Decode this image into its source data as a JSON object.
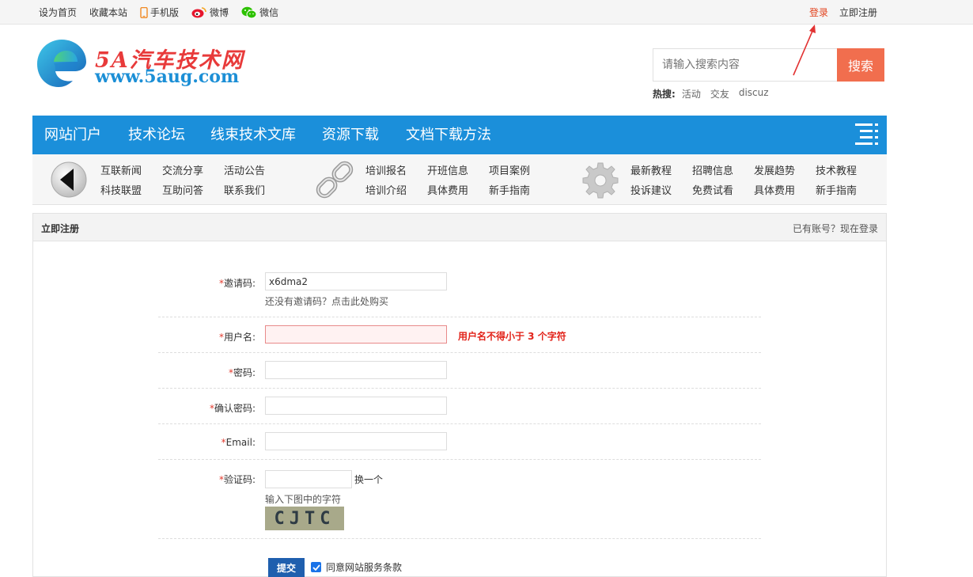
{
  "topbar": {
    "set_home": "设为首页",
    "bookmark": "收藏本站",
    "mobile": "手机版",
    "weibo": "微博",
    "wechat": "微信",
    "login": "登录",
    "register": "立即注册"
  },
  "logo": {
    "title": "5A汽车技术网",
    "url": "www.5aug.com"
  },
  "search": {
    "placeholder": "请输入搜索内容",
    "button": "搜索",
    "hot_label": "热搜:",
    "hot_keywords": [
      "活动",
      "交友",
      "discuz"
    ]
  },
  "mainnav": {
    "items": [
      "网站门户",
      "技术论坛",
      "线束技术文库",
      "资源下载",
      "文档下载方法"
    ]
  },
  "subnav": {
    "group1": [
      "互联新闻",
      "交流分享",
      "活动公告",
      "科技联盟",
      "互助问答",
      "联系我们"
    ],
    "group2": [
      "培训报名",
      "开班信息",
      "项目案例",
      "培训介绍",
      "具体费用",
      "新手指南"
    ],
    "group3": [
      "最新教程",
      "招聘信息",
      "发展趋势",
      "技术教程",
      "投诉建议",
      "免费试看",
      "具体费用",
      "新手指南"
    ]
  },
  "panel": {
    "title": "立即注册",
    "have_account": "已有账号？现在登录"
  },
  "form": {
    "invite_label": "邀请码:",
    "invite_value": "x6dma2",
    "invite_tip": "还没有邀请码？点击此处购买",
    "username_label": "用户名:",
    "username_error": "用户名不得小于 3 个字符",
    "password_label": "密码:",
    "confirm_label": "确认密码:",
    "email_label": "Email:",
    "captcha_label": "验证码:",
    "captcha_refresh": "换一个",
    "captcha_tip": "输入下图中的字符",
    "captcha_text": "CJTC",
    "star": "*",
    "submit": "提交",
    "agree": "同意网站服务条款"
  },
  "colors": {
    "nav_blue": "#1b8fda",
    "search_orange": "#f16e4e",
    "login_red": "#e2421d",
    "error_red": "#e2231a"
  }
}
